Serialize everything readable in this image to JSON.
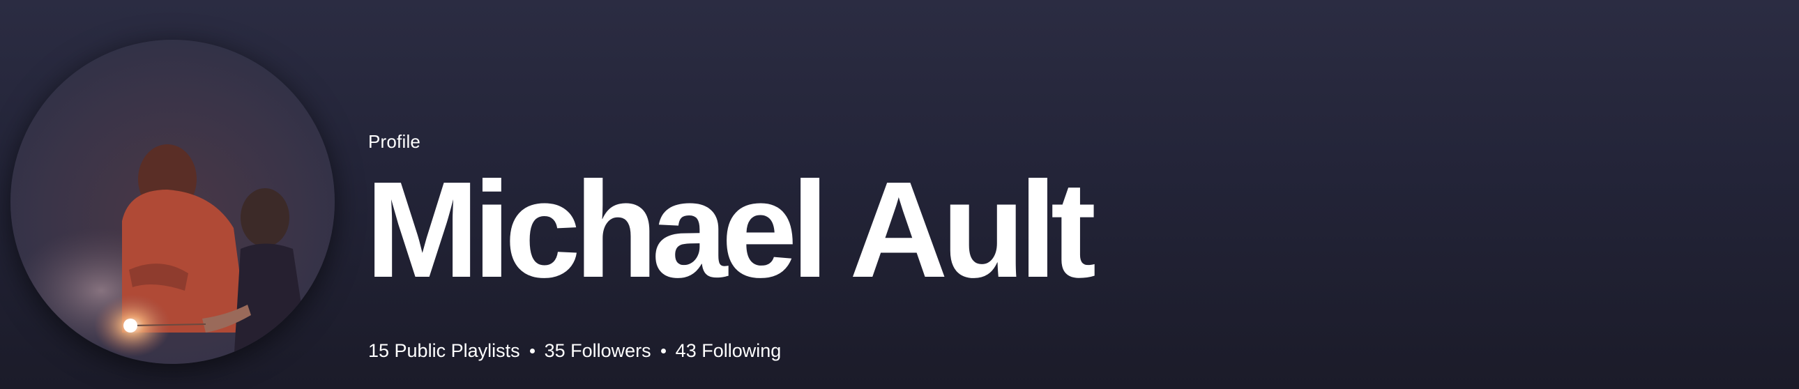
{
  "profile": {
    "type_label": "Profile",
    "name": "Michael Ault",
    "stats": {
      "playlists": "15 Public Playlists",
      "followers": "35 Followers",
      "following": "43 Following"
    }
  },
  "colors": {
    "background_top": "#2b2c42",
    "background_bottom": "#1b1b29",
    "text": "#ffffff"
  }
}
